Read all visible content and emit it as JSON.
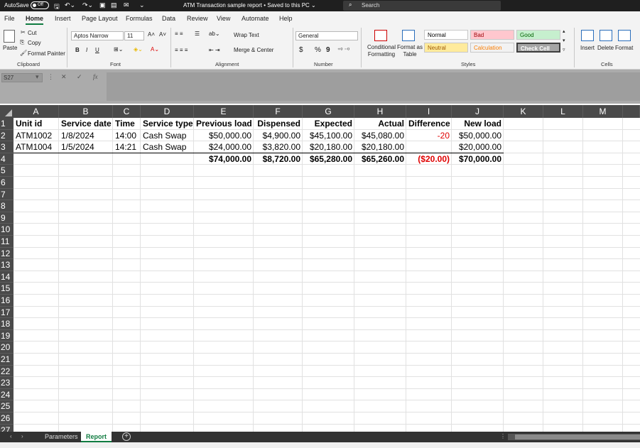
{
  "titlebar": {
    "autosave_label": "AutoSave",
    "autosave_state": "Off",
    "doc_title": "ATM Transaction sample report • Saved to this PC ⌄",
    "search_placeholder": "Search"
  },
  "menu": {
    "tabs": [
      "File",
      "Home",
      "Insert",
      "Page Layout",
      "Formulas",
      "Data",
      "Review",
      "View",
      "Automate",
      "Help"
    ],
    "active": "Home"
  },
  "ribbon": {
    "clipboard": {
      "paste": "Paste",
      "cut": "Cut",
      "copy": "Copy",
      "format_painter": "Format Painter",
      "label": "Clipboard"
    },
    "font": {
      "name": "Aptos Narrow",
      "size": "11",
      "bold": "B",
      "italic": "I",
      "underline": "U",
      "label": "Font"
    },
    "alignment": {
      "wrap_text": "Wrap Text",
      "merge_center": "Merge & Center",
      "label": "Alignment"
    },
    "number": {
      "format": "General",
      "currency": "$",
      "percent": "%",
      "comma": "9",
      "label": "Number"
    },
    "styles": {
      "conditional_formatting": "Conditional Formatting",
      "format_as_table": "Format as Table",
      "cells": [
        {
          "name": "Normal",
          "bg": "#ffffff",
          "fg": "#000000"
        },
        {
          "name": "Bad",
          "bg": "#ffc7ce",
          "fg": "#9c0006"
        },
        {
          "name": "Good",
          "bg": "#c6efce",
          "fg": "#006100"
        },
        {
          "name": "Neutral",
          "bg": "#ffeb9c",
          "fg": "#9c5700"
        },
        {
          "name": "Calculation",
          "bg": "#f2f2f2",
          "fg": "#fa7d00"
        },
        {
          "name": "Check Cell",
          "bg": "#a5a5a5",
          "fg": "#ffffff"
        }
      ],
      "label": "Styles"
    },
    "cells": {
      "insert": "Insert",
      "delete": "Delete",
      "format": "Format",
      "label": "Cells"
    }
  },
  "formula_bar": {
    "name_box": "S27",
    "fx": "fx",
    "value": ""
  },
  "sheet": {
    "columns": [
      "A",
      "B",
      "C",
      "D",
      "E",
      "F",
      "G",
      "H",
      "I",
      "J",
      "K",
      "L",
      "M"
    ],
    "row_numbers": [
      "1",
      "2",
      "3",
      "4",
      "5",
      "6",
      "7",
      "8",
      "9",
      "10",
      "11",
      "12",
      "13",
      "14",
      "15",
      "16",
      "17",
      "18",
      "19",
      "20",
      "21",
      "22",
      "23",
      "24",
      "25",
      "26",
      "27"
    ],
    "headers": [
      "Unit id",
      "Service date",
      "Time",
      "Service type",
      "Previous load",
      "Dispensed",
      "Expected",
      "Actual",
      "Difference",
      "New load"
    ],
    "rows": [
      [
        "ATM1002",
        "1/8/2024",
        "14:00",
        "Cash Swap",
        "$50,000.00",
        "$4,900.00",
        "$45,100.00",
        "$45,080.00",
        "-20",
        "$50,000.00"
      ],
      [
        "ATM1004",
        "1/5/2024",
        "14:21",
        "Cash Swap",
        "$24,000.00",
        "$3,820.00",
        "$20,180.00",
        "$20,180.00",
        "",
        "$20,000.00"
      ]
    ],
    "totals": [
      "",
      "",
      "",
      "",
      "$74,000.00",
      "$8,720.00",
      "$65,280.00",
      "$65,260.00",
      "($20.00)",
      "$70,000.00"
    ]
  },
  "sheet_tabs": {
    "tabs": [
      "Parameters",
      "Report"
    ],
    "active": "Report"
  }
}
